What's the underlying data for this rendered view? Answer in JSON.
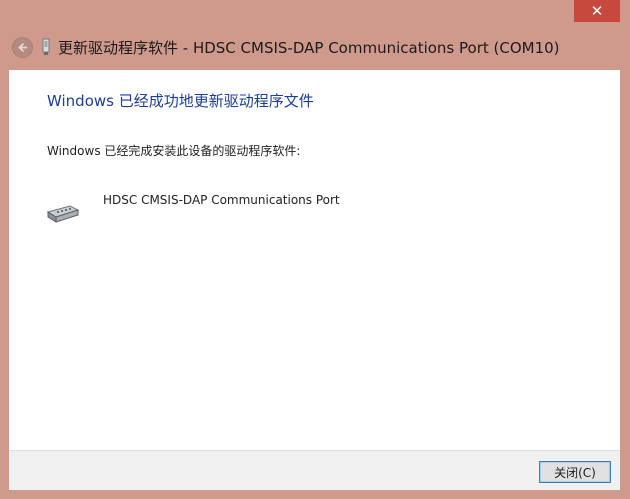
{
  "window": {
    "title": "更新驱动程序软件 - HDSC CMSIS-DAP Communications Port (COM10)",
    "close_glyph": "✕",
    "accent": "#cf9a8c"
  },
  "content": {
    "heading": "Windows 已经成功地更新驱动程序文件",
    "message": "Windows 已经完成安装此设备的驱动程序软件:",
    "device_name": "HDSC CMSIS-DAP Communications Port"
  },
  "footer": {
    "close_button": "关闭(C)"
  },
  "icons": {
    "back": "back-arrow-icon",
    "wizard": "hardware-wizard-icon",
    "device": "serial-port-icon",
    "close": "close-icon"
  }
}
